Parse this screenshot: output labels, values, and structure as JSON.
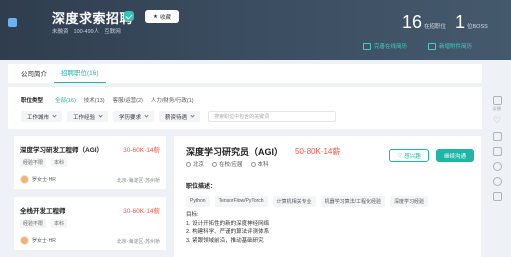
{
  "header": {
    "company_name": "深度求索招聘",
    "favorite_label": "收藏",
    "meta": [
      "未融资",
      "100-499人",
      "互联网"
    ],
    "stats": [
      {
        "num": "16",
        "label": "在招职位"
      },
      {
        "num": "1",
        "label": "位BOSS"
      }
    ],
    "links": {
      "improve_resume": "完善在线简历",
      "new_attachment": "新增附件简历"
    }
  },
  "tabs": [
    {
      "label": "公司简介"
    },
    {
      "label": "招聘职位(16)"
    }
  ],
  "filters": {
    "type_title": "职位类型",
    "types": [
      "全部(16)",
      "技术(13)",
      "客服/运营(2)",
      "人力/财务/行政(1)"
    ],
    "chips": [
      "工作城市",
      "工作经验",
      "学历要求",
      "薪资待遇"
    ],
    "search_placeholder": "搜索职位中包含的关键词"
  },
  "jobs": [
    {
      "title": "深度学习研发工程师（AGI）",
      "salary": "30-60K·14薪",
      "tags": [
        "经验不限",
        "本科"
      ],
      "hr": "罗女士·HR",
      "location": "北京·海淀区·苏州桥"
    },
    {
      "title": "全栈开发工程师",
      "salary": "30-60K·14薪",
      "tags": [
        "经验不限",
        "本科"
      ],
      "hr": "罗女士·HR",
      "location": "北京·海淀区·苏州桥"
    }
  ],
  "detail": {
    "title": "深度学习研究员（AGI）",
    "salary": "50-80K·14薪",
    "meta": [
      "北京",
      "在校/应届",
      "本科"
    ],
    "interest_label": "感兴趣",
    "chat_label": "继续沟通",
    "desc_label": "职位描述：",
    "skills": [
      "Python",
      "TensorFlow/PyTorch",
      "计算机相关专业",
      "机器学习算法/工程化经验",
      "深度学习经验"
    ],
    "body": [
      "目标:",
      "1. 设计开拓性的新的深度神经网络",
      "2. 构建科学、严谨的算法评测体系",
      "3. 紧跟领域前沿，推动基础研究"
    ]
  },
  "sidebar": [
    {
      "icon": "chat-icon",
      "label": "反馈"
    },
    {
      "icon": "heart-icon",
      "label": ""
    },
    {
      "icon": "message-icon",
      "label": ""
    },
    {
      "icon": "send-icon",
      "label": ""
    },
    {
      "icon": "pin-icon",
      "label": ""
    },
    {
      "icon": "refresh-icon",
      "label": ""
    },
    {
      "icon": "app-icon",
      "label": ""
    }
  ]
}
